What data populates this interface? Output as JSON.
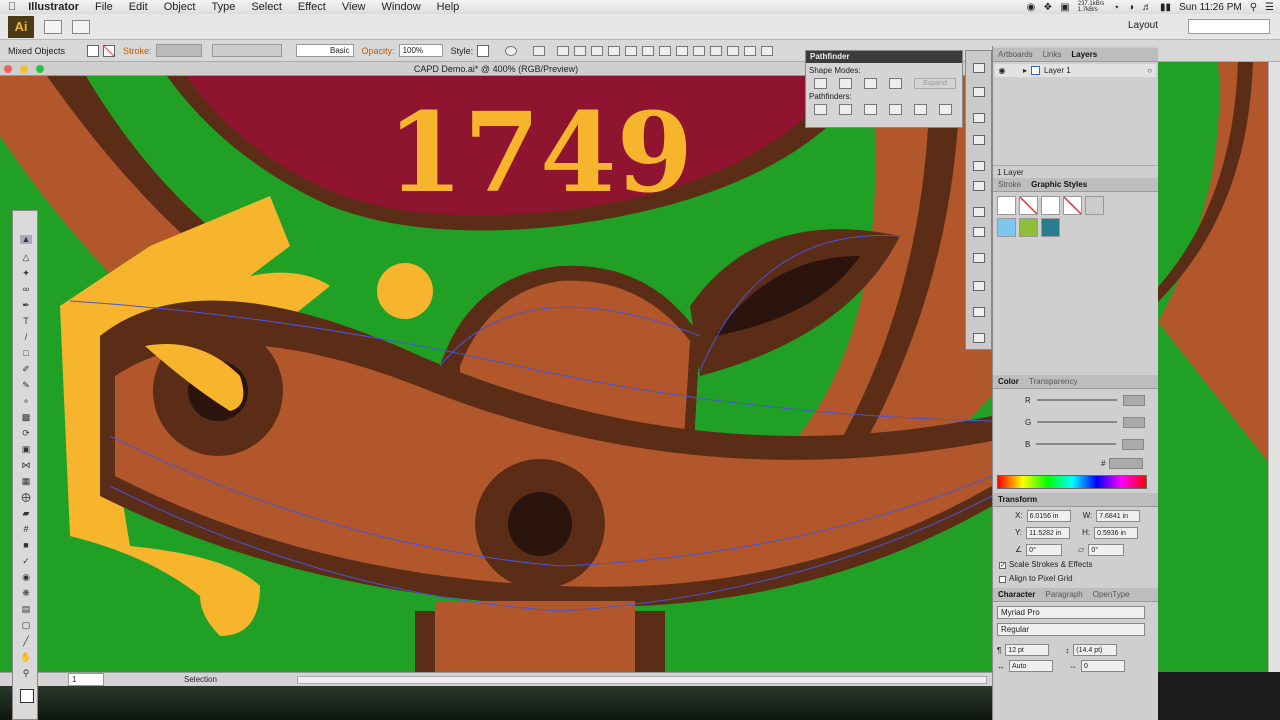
{
  "menubar": {
    "app": "Illustrator",
    "items": [
      "File",
      "Edit",
      "Object",
      "Type",
      "Select",
      "Effect",
      "View",
      "Window",
      "Help"
    ],
    "net_rates": "237.1kB/s 1.7kB/s",
    "clock": "Sun 11:26 PM"
  },
  "appbar": {
    "logo": "Ai",
    "layout_label": "Layout"
  },
  "control": {
    "selection_label": "Mixed Objects",
    "stroke_label": "Stroke:",
    "brush_label": "Basic",
    "opacity_label": "Opacity:",
    "opacity_value": "100%",
    "style_label": "Style:"
  },
  "document": {
    "title": "CAPD Demo.ai* @ 400% (RGB/Preview)"
  },
  "artwork": {
    "year": "1749"
  },
  "status": {
    "zoom": "1",
    "tool": "Selection"
  },
  "pathfinder": {
    "title": "Pathfinder",
    "shape_modes": "Shape Modes:",
    "pathfinders": "Pathfinders:",
    "expand": "Expand"
  },
  "layers_panel": {
    "tabs": [
      "Artboards",
      "Links",
      "Layers"
    ],
    "active_tab": "Layers",
    "layers": [
      {
        "name": "Layer 1"
      }
    ],
    "count": "1 Layer"
  },
  "styles_panel": {
    "tabs": [
      "Stroke",
      "Graphic Styles"
    ],
    "active_tab": "Graphic Styles"
  },
  "color_panel": {
    "tabs": [
      "Color",
      "Transparency"
    ],
    "active_tab": "Color",
    "channels": [
      "R",
      "G",
      "B"
    ],
    "hex_label": "#"
  },
  "transform_panel": {
    "title": "Transform",
    "x_label": "X:",
    "x": "6.0156 in",
    "y_label": "Y:",
    "y": "11.5282 in",
    "w_label": "W:",
    "w": "7.6841 in",
    "h_label": "H:",
    "h": "0.5936 in",
    "angle": "0°",
    "shear": "0°",
    "scale_strokes": "Scale Strokes & Effects",
    "align_pixel": "Align to Pixel Grid"
  },
  "character_panel": {
    "tabs": [
      "Character",
      "Paragraph",
      "OpenType"
    ],
    "active_tab": "Character",
    "font": "Myriad Pro",
    "style": "Regular",
    "size": "12 pt",
    "leading": "(14.4 pt)",
    "kerning": "Auto",
    "tracking": "0"
  },
  "colors": {
    "canvas_green": "#21a026",
    "maroon": "#8f1430",
    "leather": "#b2572c",
    "dark_brown": "#5b2c16",
    "gold": "#f7b52e",
    "selection_blue": "#4a56d6"
  }
}
